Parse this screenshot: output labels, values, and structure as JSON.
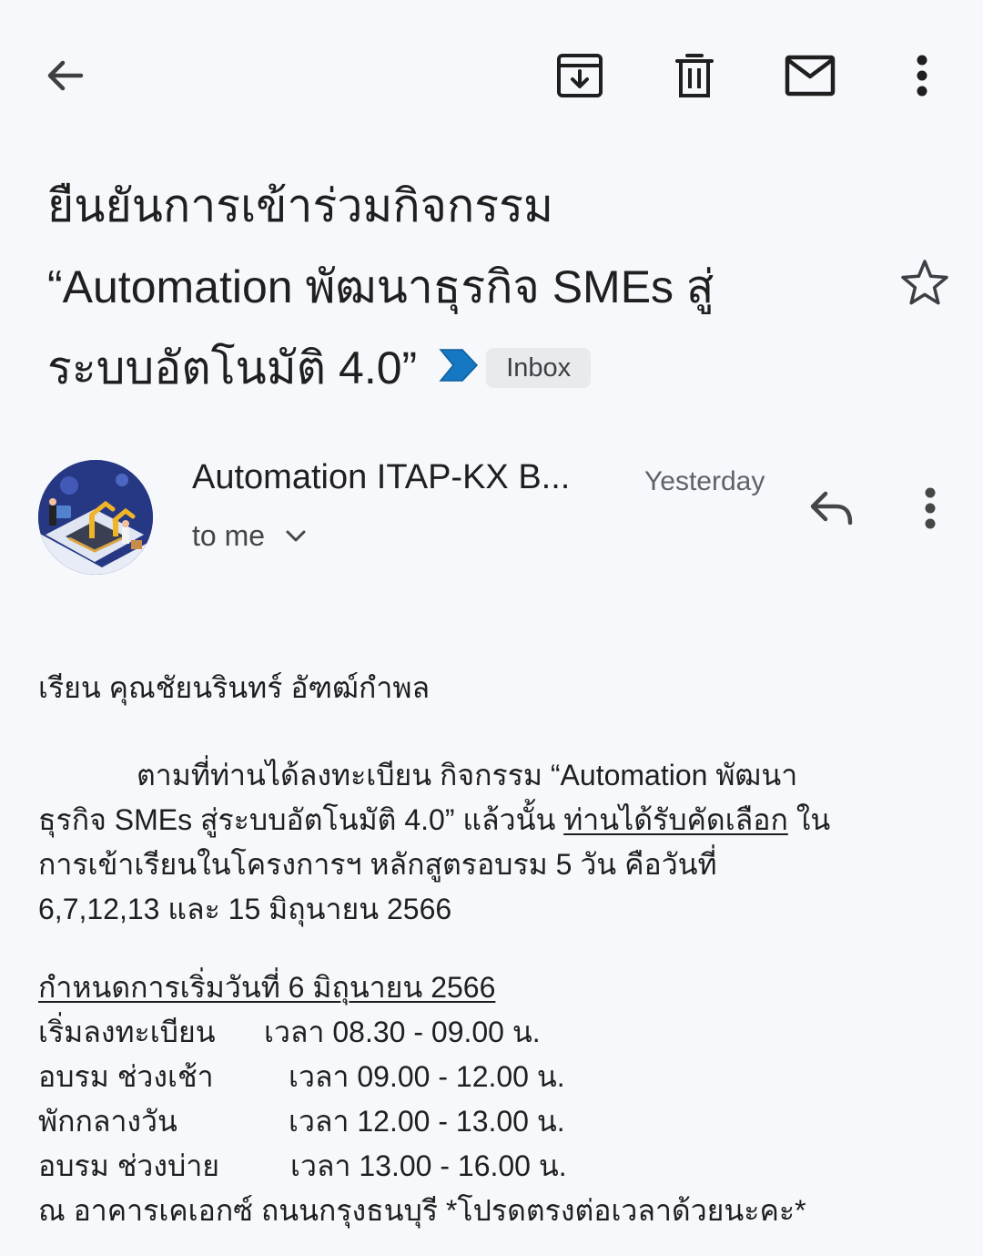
{
  "toolbar": {
    "back_icon": "arrow-left-icon",
    "archive_icon": "archive-icon",
    "delete_icon": "trash-icon",
    "mark_unread_icon": "mail-icon",
    "more_icon": "more-vert-icon"
  },
  "email": {
    "subject_line1": "ยืนยันการเข้าร่วมกิจกรรม",
    "subject_line2": "“Automation พัฒนาธุรกิจ SMEs สู่",
    "subject_line3": "ระบบอัตโนมัติ 4.0”",
    "label": "Inbox",
    "sender": "Automation ITAP-KX B...",
    "date": "Yesterday",
    "recipient": "to me",
    "greeting": "เรียน  คุณชัยนรินทร์ อัฑฒ์กำพล",
    "para_line1": "ตามที่ท่านได้ลงทะเบียน กิจกรรม “Automation พัฒนา",
    "para_line2_a": "ธุรกิจ SMEs สู่ระบบอัตโนมัติ 4.0” แล้วนั้น ",
    "para_line2_link": "ท่านได้รับคัดเลือก",
    "para_line2_b": " ใน",
    "para_line3": "การเข้าเรียนในโครงการฯ หลักสูตรอบรม 5 วัน คือวันที่",
    "para_line4": "6,7,12,13 และ 15 มิถุนายน 2566",
    "schedule_title": "กำหนดการเริ่มวันที่ 6 มิถุนายน 2566",
    "schedule": [
      {
        "label": "เริ่มลงทะเบียน",
        "time": "เวลา 08.30 - 09.00 น."
      },
      {
        "label": "อบรม ช่วงเช้า",
        "time": "เวลา 09.00 - 12.00 น."
      },
      {
        "label": "พักกลางวัน",
        "time": "เวลา 12.00 - 13.00 น."
      },
      {
        "label": "อบรม ช่วงบ่าย",
        "time": "เวลา 13.00 - 16.00 น."
      }
    ],
    "location": "ณ อาคารเคเอกซ์  ถนนกรุงธนบุรี  *โปรดตรงต่อเวลาด้วยนะคะ*"
  },
  "colors": {
    "background": "#f6f8fc",
    "importance_marker": "#1a73e8",
    "chip_bg": "#e9eaee"
  }
}
